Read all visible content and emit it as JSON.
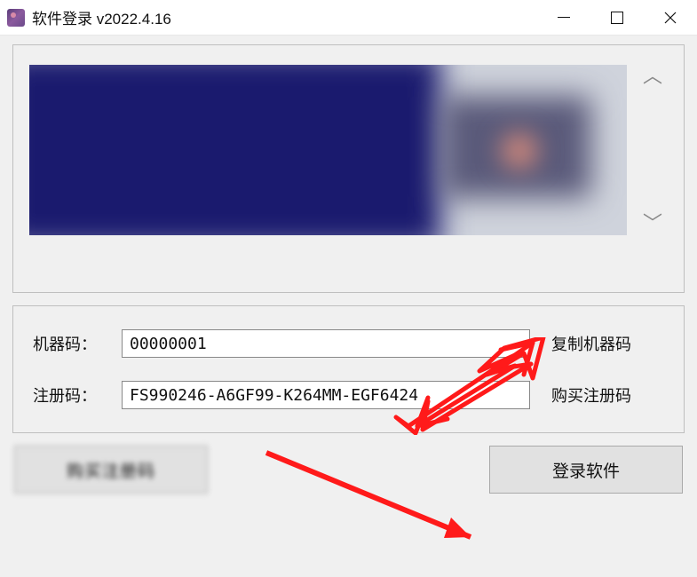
{
  "window": {
    "title": "软件登录 v2022.4.16"
  },
  "form": {
    "machine_code_label": "机器码：",
    "machine_code_value": "00000001",
    "copy_machine_link": "复制机器码",
    "reg_code_label": "注册码：",
    "reg_code_value": "FS990246-A6GF99-K264MM-EGF6424",
    "buy_reg_link": "购买注册码"
  },
  "buttons": {
    "left_blurred": "购买注册码",
    "login": "登录软件"
  }
}
